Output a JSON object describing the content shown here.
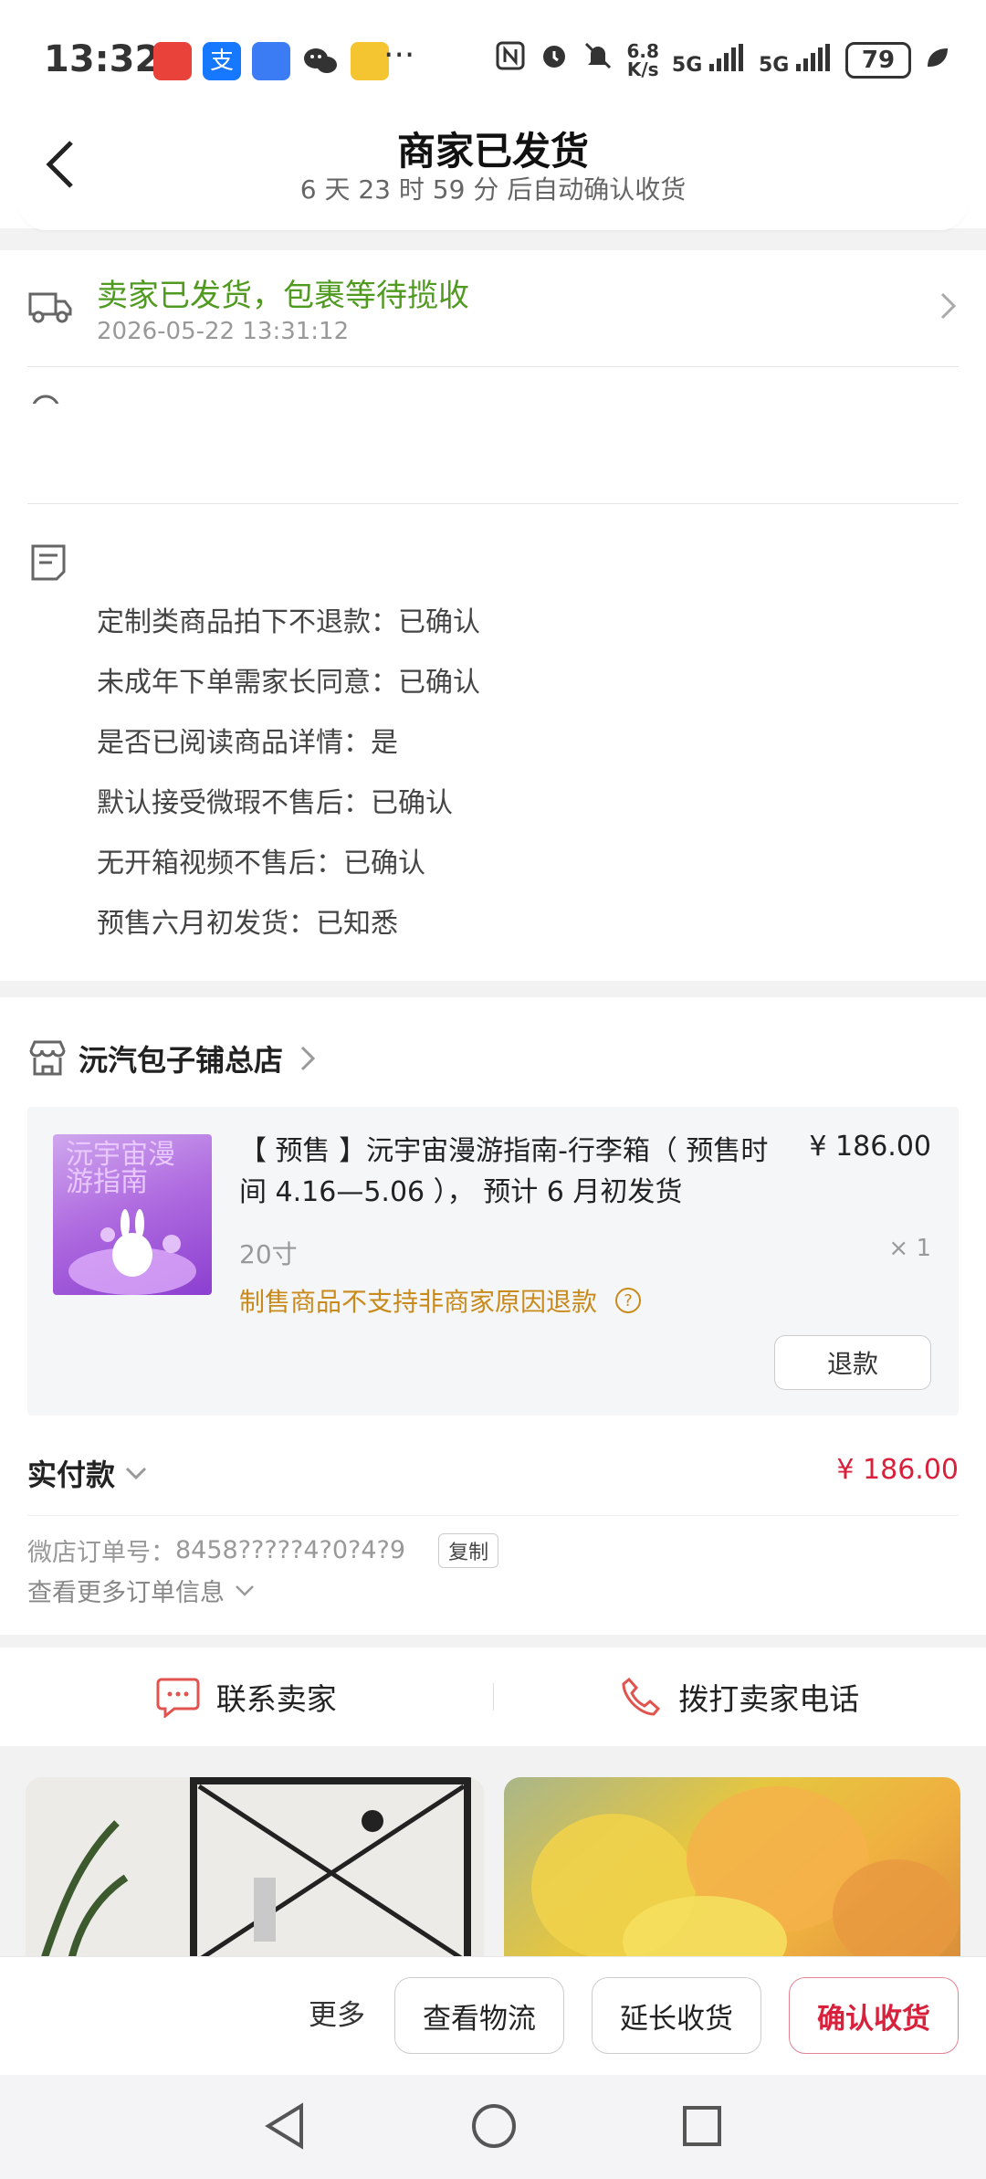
{
  "status_bar": {
    "time": "13:32",
    "more": "···",
    "net_speed_top": "6.8",
    "net_speed_bottom": "K/s",
    "net1": "5G",
    "net2": "5G",
    "battery": "79",
    "app_icons": [
      "xinhua-news-icon",
      "alipay-icon",
      "assistant-icon",
      "wechat-icon",
      "weibo-icon"
    ],
    "status_icons": [
      "nfc-icon",
      "alarm-icon",
      "mute-icon",
      "signal-icon",
      "leaf-icon"
    ]
  },
  "header": {
    "title": "商家已发货",
    "subtitle": "6 天 23 时 59 分  后自动确认收货"
  },
  "shipping": {
    "status": "卖家已发货，包裹等待揽收",
    "time": "2026-05-22 13:31:12",
    "status_color": "#4f9a1f"
  },
  "remarks": [
    "定制类商品拍下不退款：已确认",
    "未成年下单需家长同意：已确认",
    "是否已阅读商品详情：是",
    "默认接受微瑕不售后：已确认",
    "无开箱视频不售后：已确认",
    "预售六月初发货：已知悉"
  ],
  "shop": {
    "name": "沅汽包子铺总店",
    "item": {
      "thumb_text": "沅宇宙漫游指南",
      "title": "【 预售 】沅宇宙漫游指南-行李箱（ 预售时间 4.16—5.06 ）， 预计 6 月初发货",
      "price": "¥ 186.00",
      "spec": "20寸",
      "qty": "× 1",
      "warning": "制售商品不支持非商家原因退款",
      "refund_label": "退款"
    },
    "paid_label": "实付款",
    "paid_value": "¥ 186.00",
    "order_label": "微店订单号：",
    "order_no": "8458?????4?0?4?9",
    "copy_label": "复制",
    "more_info": "查看更多订单信息"
  },
  "contact": {
    "seller": "联系卖家",
    "phone": "拨打卖家电话"
  },
  "actions": {
    "more": "更多",
    "logistics": "查看物流",
    "extend": "延长收货",
    "confirm": "确认收货"
  },
  "colors": {
    "accent_red": "#d8213c",
    "warning_orange": "#c98a1c",
    "ship_green": "#4f9a1f"
  }
}
